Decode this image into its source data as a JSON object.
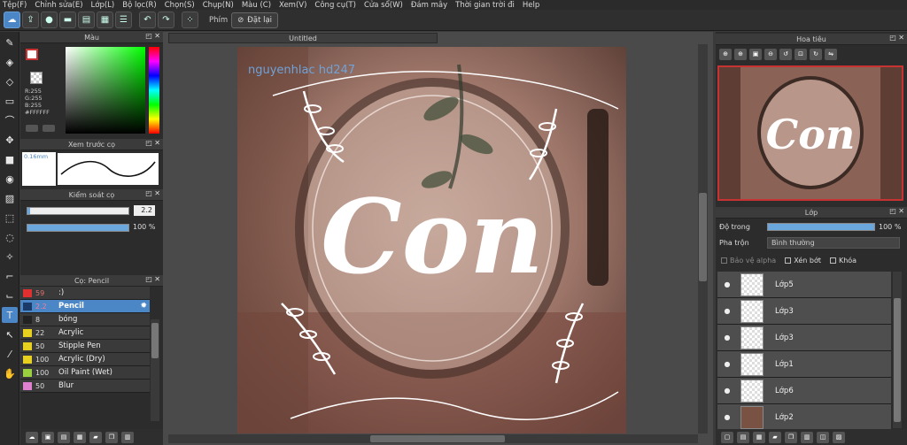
{
  "menu": [
    "Tệp(F)",
    "Chỉnh sửa(E)",
    "Lớp(L)",
    "Bộ lọc(R)",
    "Chọn(S)",
    "Chụp(N)",
    "Màu (C)",
    "Xem(V)",
    "Công cụ(T)",
    "Cửa sổ(W)",
    "Đám mây",
    "Thời gian trời đi",
    "Help"
  ],
  "toolbar": {
    "key_label": "Phím",
    "reset_label": "Đặt lại"
  },
  "color_panel": {
    "title": "Màu",
    "r": "R:255",
    "g": "G:255",
    "b": "B:255",
    "hex": "#FFFFFF"
  },
  "brush_preview": {
    "title": "Xem trước cọ",
    "size": "0.16mm"
  },
  "brush_control": {
    "title": "Kiểm soát cọ",
    "size_value": "2.2",
    "opacity_value": "100 %",
    "size_fraction": 0.97,
    "opacity_fraction": 1.0
  },
  "brush_panel": {
    "title": "Cọ: Pencil",
    "items": [
      {
        "size": "59",
        "name": ":)",
        "color": "#e03030"
      },
      {
        "size": "2.2",
        "name": "Pencil",
        "color": "#1a3a6a"
      },
      {
        "size": "8",
        "name": "bóng",
        "color": "#222222"
      },
      {
        "size": "22",
        "name": "Acrylic",
        "color": "#e8d020"
      },
      {
        "size": "50",
        "name": "Stipple Pen",
        "color": "#e8d020"
      },
      {
        "size": "100",
        "name": "Acrylic (Dry)",
        "color": "#e8d020"
      },
      {
        "size": "100",
        "name": "Oil Paint (Wet)",
        "color": "#9ad040"
      },
      {
        "size": "50",
        "name": "Blur",
        "color": "#e080d0"
      }
    ]
  },
  "canvas": {
    "tab_title": "Untitled",
    "watermark": "nguyenhlac hd247",
    "art_text": "Con"
  },
  "navigator": {
    "title": "Hoa tiêu",
    "art_text": "Con"
  },
  "layers_panel": {
    "title": "Lớp",
    "opacity_label": "Độ trong",
    "opacity_value": "100 %",
    "opacity_fraction": 1.0,
    "blend_label": "Pha trộn",
    "blend_value": "Bình thường",
    "protect_alpha": "Bảo vệ alpha",
    "clipping": "Xén bớt",
    "lock": "Khóa",
    "layers": [
      "Lớp5",
      "Lớp3",
      "Lớp3",
      "Lớp1",
      "Lớp6",
      "Lớp2"
    ]
  }
}
